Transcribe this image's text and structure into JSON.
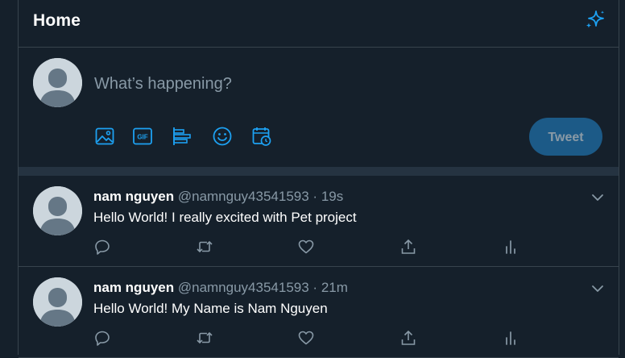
{
  "header": {
    "title": "Home",
    "icon": "sparkle-icon"
  },
  "composer": {
    "placeholder": "What’s happening?",
    "tools": [
      "image-icon",
      "gif-icon",
      "poll-icon",
      "emoji-icon",
      "schedule-icon"
    ],
    "gif_label": "GIF",
    "tweet_label": "Tweet"
  },
  "tweets": [
    {
      "name": "nam nguyen",
      "handle": "@namnguy43541593",
      "separator": "·",
      "time": "19s",
      "text": "Hello World! I really excited with Pet project"
    },
    {
      "name": "nam nguyen",
      "handle": "@namnguy43541593",
      "separator": "·",
      "time": "21m",
      "text": "Hello World! My Name is Nam Nguyen"
    }
  ],
  "actions": [
    "reply-icon",
    "retweet-icon",
    "like-icon",
    "share-icon",
    "analytics-icon"
  ],
  "colors": {
    "background": "#15202b",
    "border": "#38444d",
    "accent": "#1da1f2",
    "muted": "#8899a6",
    "tweet_button": "#1c5a87",
    "separator": "#253341"
  }
}
